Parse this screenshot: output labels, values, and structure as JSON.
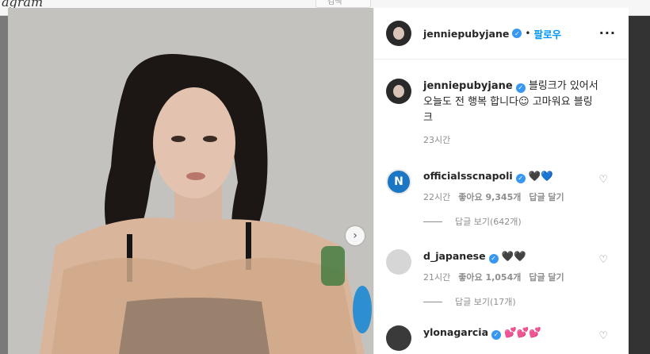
{
  "app": {
    "logo_text": "agram",
    "search_placeholder": "검색"
  },
  "post": {
    "username": "jenniерubyjane",
    "follow_label": "팔로우",
    "more_label": "···",
    "caption_text": "블링크가 있어서 오늘도 전 행복 합니다☺ 고마워요 블링크",
    "caption_time": "23시간"
  },
  "comments": [
    {
      "username": "officialsscnapoli",
      "text": "🖤💙",
      "time": "22시간",
      "likes": "좋아요 9,345개",
      "reply": "답글 달기",
      "view_replies": "답글 보기(642개)",
      "avatar_letter": "N"
    },
    {
      "username": "d_japanese",
      "text": "🖤🖤",
      "time": "21시간",
      "likes": "좋아요 1,054개",
      "reply": "답글 달기",
      "view_replies": "답글 보기(17개)"
    },
    {
      "username": "ylonagarcia",
      "text": "💕💕💕"
    }
  ],
  "colors": {
    "accent": "#0095f6",
    "verified": "#3897f0",
    "meta": "#8e8e8e"
  }
}
